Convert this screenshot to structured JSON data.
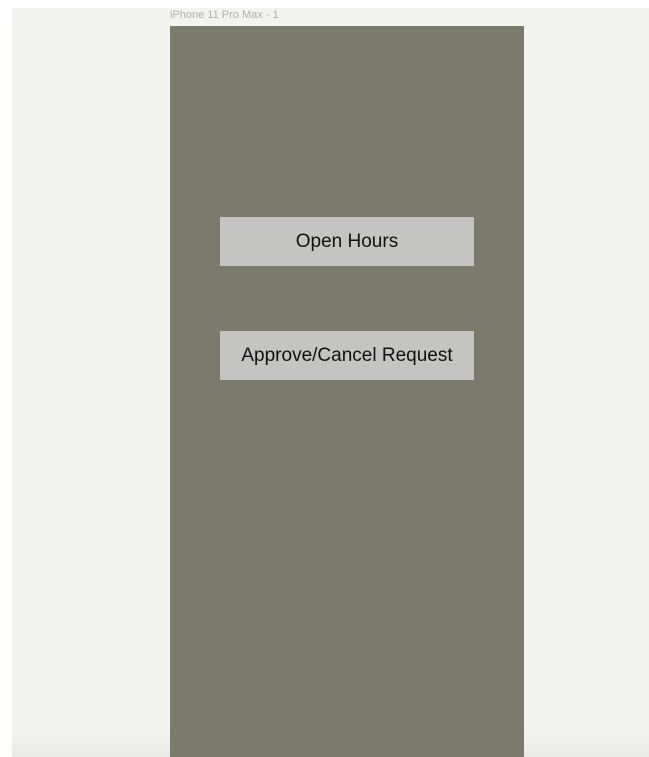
{
  "frame": {
    "label": "iPhone 11 Pro Max - 1"
  },
  "buttons": {
    "open_hours": "Open Hours",
    "approve_cancel_request": "Approve/Cancel Request"
  },
  "colors": {
    "canvas_background": "#f3f3ef",
    "artboard_background": "#7a7a6d",
    "button_background": "#c4c4c3",
    "button_text": "#111111",
    "frame_label_text": "#b0b0aa"
  }
}
